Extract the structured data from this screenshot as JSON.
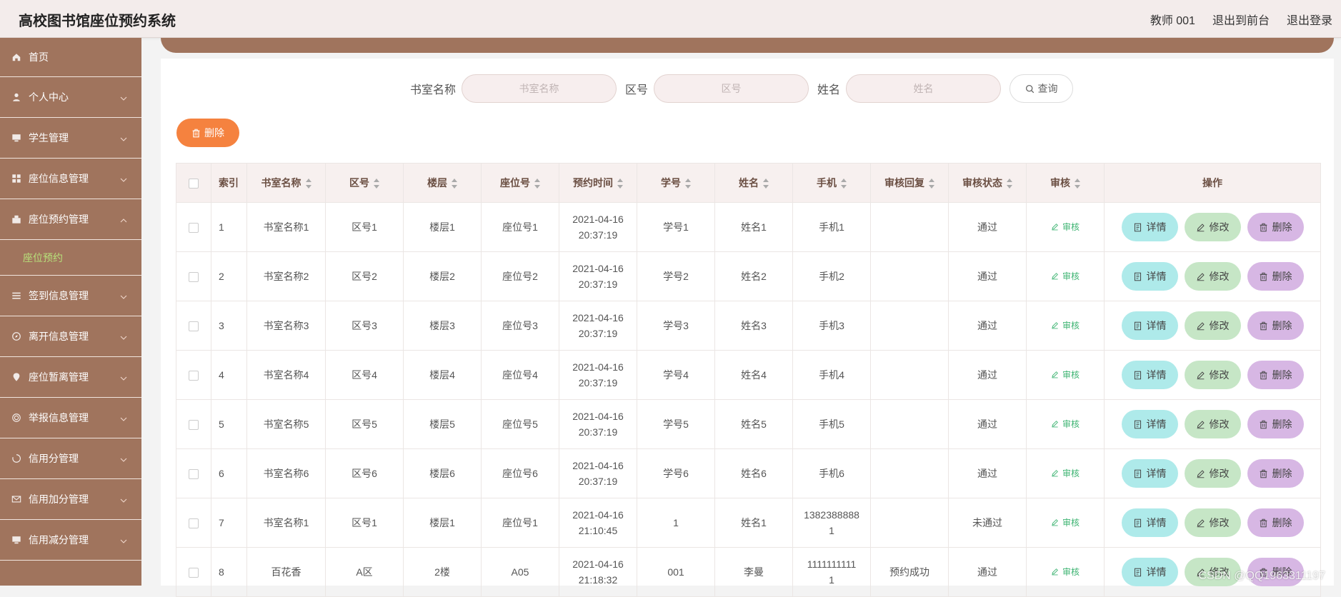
{
  "header": {
    "title": "高校图书馆座位预约系统",
    "user": "教师 001",
    "to_front": "退出到前台",
    "logout": "退出登录"
  },
  "sidebar": {
    "items": [
      {
        "label": "首页",
        "icon": "home-icon"
      },
      {
        "label": "个人中心",
        "icon": "user-icon"
      },
      {
        "label": "学生管理",
        "icon": "monitor-icon"
      },
      {
        "label": "座位信息管理",
        "icon": "grid-icon"
      },
      {
        "label": "座位预约管理",
        "icon": "building-icon",
        "expanded": true
      },
      {
        "label": "签到信息管理",
        "icon": "list-icon"
      },
      {
        "label": "离开信息管理",
        "icon": "compass-icon"
      },
      {
        "label": "座位暂离管理",
        "icon": "location-icon"
      },
      {
        "label": "举报信息管理",
        "icon": "target-icon"
      },
      {
        "label": "信用分管理",
        "icon": "loading-icon"
      },
      {
        "label": "信用加分管理",
        "icon": "mail-icon"
      },
      {
        "label": "信用减分管理",
        "icon": "monitor-icon"
      }
    ],
    "sub_item": "座位预约",
    "active_color": "#b7e07a"
  },
  "search": {
    "room_label": "书室名称",
    "room_placeholder": "书室名称",
    "area_label": "区号",
    "area_placeholder": "区号",
    "name_label": "姓名",
    "name_placeholder": "姓名",
    "query_button": "查询"
  },
  "toolbar": {
    "delete_label": "删除"
  },
  "table": {
    "headers": [
      "索引",
      "书室名称",
      "区号",
      "楼层",
      "座位号",
      "预约时间",
      "学号",
      "姓名",
      "手机",
      "审核回复",
      "审核状态",
      "审核",
      "操作"
    ],
    "audit_label": "审核",
    "detail_label": "详情",
    "edit_label": "修改",
    "delete_label": "删除",
    "rows": [
      {
        "idx": "1",
        "room": "书室名称1",
        "area": "区号1",
        "floor": "楼层1",
        "seat": "座位号1",
        "date": "2021-04-16",
        "time": "20:37:19",
        "sid": "学号1",
        "name": "姓名1",
        "phone1": "手机1",
        "phone2": "",
        "reply": "",
        "status": "通过"
      },
      {
        "idx": "2",
        "room": "书室名称2",
        "area": "区号2",
        "floor": "楼层2",
        "seat": "座位号2",
        "date": "2021-04-16",
        "time": "20:37:19",
        "sid": "学号2",
        "name": "姓名2",
        "phone1": "手机2",
        "phone2": "",
        "reply": "",
        "status": "通过"
      },
      {
        "idx": "3",
        "room": "书室名称3",
        "area": "区号3",
        "floor": "楼层3",
        "seat": "座位号3",
        "date": "2021-04-16",
        "time": "20:37:19",
        "sid": "学号3",
        "name": "姓名3",
        "phone1": "手机3",
        "phone2": "",
        "reply": "",
        "status": "通过"
      },
      {
        "idx": "4",
        "room": "书室名称4",
        "area": "区号4",
        "floor": "楼层4",
        "seat": "座位号4",
        "date": "2021-04-16",
        "time": "20:37:19",
        "sid": "学号4",
        "name": "姓名4",
        "phone1": "手机4",
        "phone2": "",
        "reply": "",
        "status": "通过"
      },
      {
        "idx": "5",
        "room": "书室名称5",
        "area": "区号5",
        "floor": "楼层5",
        "seat": "座位号5",
        "date": "2021-04-16",
        "time": "20:37:19",
        "sid": "学号5",
        "name": "姓名5",
        "phone1": "手机5",
        "phone2": "",
        "reply": "",
        "status": "通过"
      },
      {
        "idx": "6",
        "room": "书室名称6",
        "area": "区号6",
        "floor": "楼层6",
        "seat": "座位号6",
        "date": "2021-04-16",
        "time": "20:37:19",
        "sid": "学号6",
        "name": "姓名6",
        "phone1": "手机6",
        "phone2": "",
        "reply": "",
        "status": "通过"
      },
      {
        "idx": "7",
        "room": "书室名称1",
        "area": "区号1",
        "floor": "楼层1",
        "seat": "座位号1",
        "date": "2021-04-16",
        "time": "21:10:45",
        "sid": "1",
        "name": "姓名1",
        "phone1": "1382388888",
        "phone2": "1",
        "reply": "",
        "status": "未通过"
      },
      {
        "idx": "8",
        "room": "百花香",
        "area": "A区",
        "floor": "2楼",
        "seat": "A05",
        "date": "2021-04-16",
        "time": "21:18:32",
        "sid": "001",
        "name": "李曼",
        "phone1": "1111111111",
        "phone2": "1",
        "reply": "预约成功",
        "status": "通过"
      }
    ]
  },
  "colors": {
    "sidebar_bg": "#a0745d",
    "header_bg": "#f3eceb",
    "delete_button": "#f5823f",
    "detail_button": "#aeeaea",
    "edit_button": "#c6e6c6",
    "remove_button": "#d7b7e4",
    "audit_link": "#3cb371"
  },
  "watermark": "CSDN @QQ1963311197"
}
